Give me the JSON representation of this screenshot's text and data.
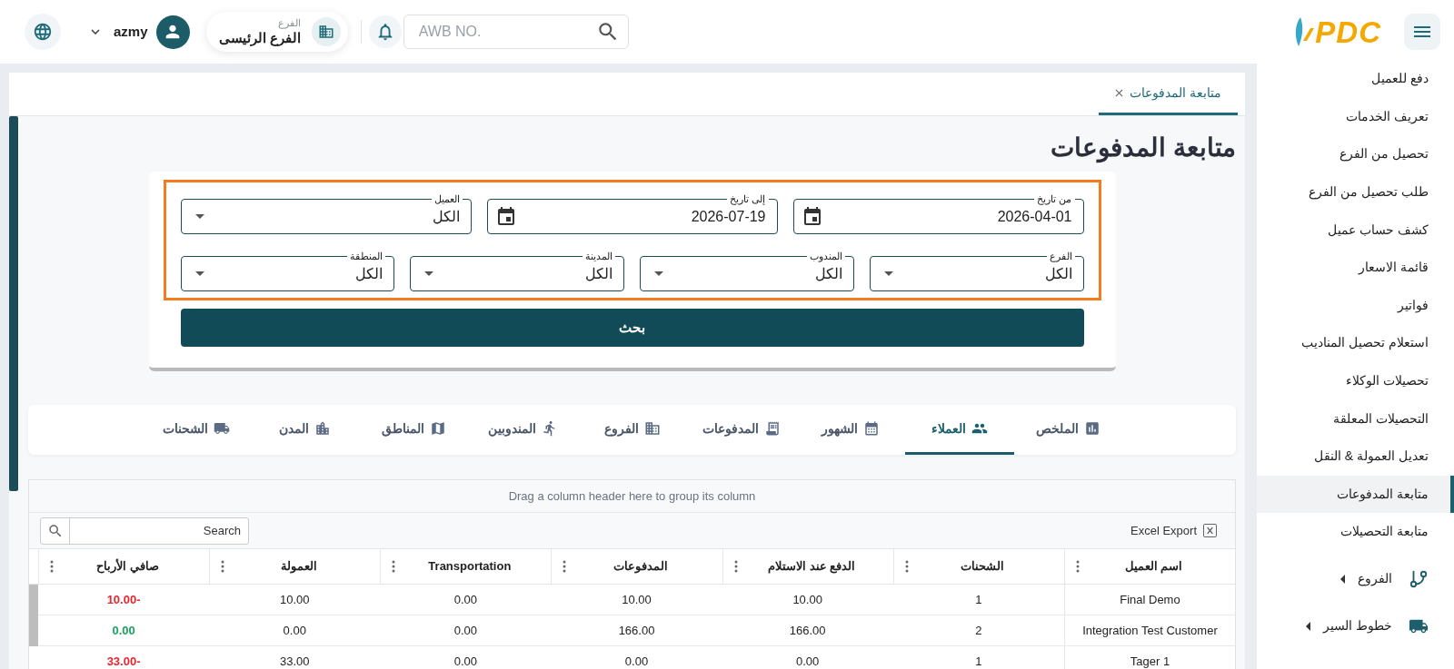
{
  "top_bar": {
    "logo": "PDC",
    "search": {
      "placeholder": "AWB NO."
    },
    "branch": {
      "label": "الفرع",
      "value": "الفرع الرئيسى"
    },
    "user": {
      "name": "azmy"
    }
  },
  "sidebar": {
    "items": [
      {
        "label": "دفع للعميل",
        "kind": "link",
        "selected": false
      },
      {
        "label": "تعريف الخدمات",
        "kind": "link",
        "selected": false
      },
      {
        "label": "تحصيل من الفرع",
        "kind": "link",
        "selected": false
      },
      {
        "label": "طلب تحصيل من الفرع",
        "kind": "link",
        "selected": false
      },
      {
        "label": "كشف حساب عميل",
        "kind": "link",
        "selected": false
      },
      {
        "label": "قائمة الاسعار",
        "kind": "link",
        "selected": false
      },
      {
        "label": "فواتير",
        "kind": "link",
        "selected": false
      },
      {
        "label": "استعلام تحصيل المناديب",
        "kind": "link",
        "selected": false
      },
      {
        "label": "تحصيلات الوكلاء",
        "kind": "link",
        "selected": false
      },
      {
        "label": "التحصيلات المعلقة",
        "kind": "link",
        "selected": false
      },
      {
        "label": "تعديل العمولة & النقل",
        "kind": "link",
        "selected": false
      },
      {
        "label": "متابعة المدفوعات",
        "kind": "link",
        "selected": true
      },
      {
        "label": "متابعة التحصيلات",
        "kind": "link",
        "selected": false
      },
      {
        "label": "الفروع",
        "kind": "group",
        "selected": false,
        "expanded": false
      },
      {
        "label": "خطوط السير",
        "kind": "group",
        "selected": false,
        "expanded": false
      }
    ]
  },
  "page_tabs": [
    {
      "label": "متابعة المدفوعات",
      "selected": true
    }
  ],
  "page_title": "متابعة المدفوعات",
  "filters": {
    "rows": [
      [
        {
          "label": "من تاريخ",
          "value": "2026-04-01",
          "kind": "date"
        },
        {
          "label": "إلى تاريخ",
          "value": "2026-07-19",
          "kind": "date"
        },
        {
          "label": "العميل",
          "value": "الكل",
          "kind": "select"
        }
      ],
      [
        {
          "label": "الفرع",
          "value": "الكل",
          "kind": "select"
        },
        {
          "label": "المندوب",
          "value": "الكل",
          "kind": "select"
        },
        {
          "label": "المدينة",
          "value": "الكل",
          "kind": "select"
        },
        {
          "label": "المنطقة",
          "value": "الكل",
          "kind": "select"
        }
      ]
    ],
    "search_button": "بحث"
  },
  "report_tabs": [
    {
      "label": "الملخص",
      "selected": false
    },
    {
      "label": "العملاء",
      "selected": true
    },
    {
      "label": "الشهور",
      "selected": false
    },
    {
      "label": "المدفوعات",
      "selected": false
    },
    {
      "label": "الفروع",
      "selected": false
    },
    {
      "label": "المندوبين",
      "selected": false
    },
    {
      "label": "المناطق",
      "selected": false
    },
    {
      "label": "المدن",
      "selected": false
    },
    {
      "label": "الشحنات",
      "selected": false
    }
  ],
  "grid": {
    "group_panel": "Drag a column header here to group its column",
    "search": {
      "placeholder": "Search"
    },
    "export_button": "Excel Export",
    "columns": [
      "اسم العميل",
      "الشحنات",
      "الدفع عند الاستلام",
      "المدفوعات",
      "Transportation",
      "العمولة",
      "صافي الأرباح"
    ],
    "rows": [
      {
        "cells": [
          "Final Demo",
          "1",
          "10.00",
          "10.00",
          "0.00",
          "10.00"
        ],
        "net_profit": {
          "text": "10.00-",
          "color": "#e3262f"
        }
      },
      {
        "cells": [
          "Integration Test Customer",
          "2",
          "166.00",
          "166.00",
          "0.00",
          "0.00"
        ],
        "net_profit": {
          "text": "0.00",
          "color": "#1aa260"
        }
      },
      {
        "cells": [
          "Tager 1",
          "1",
          "0.00",
          "0.00",
          "0.00",
          "33.00"
        ],
        "net_profit": {
          "text": "33.00-",
          "color": "#e3262f"
        }
      }
    ]
  }
}
